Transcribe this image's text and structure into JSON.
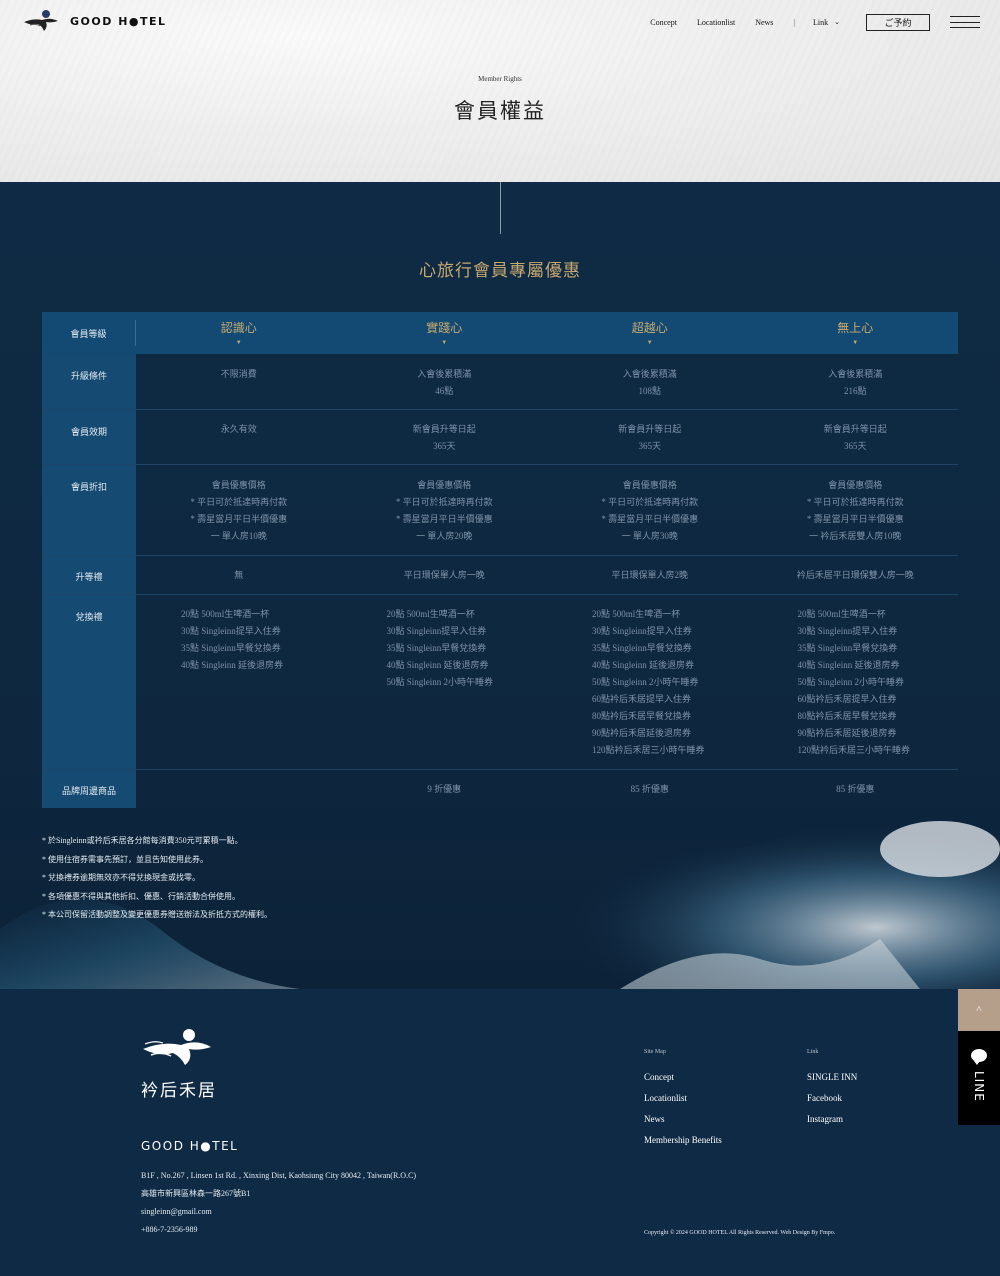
{
  "header": {
    "brand": "GOOD H●TEL",
    "nav": [
      "Concept",
      "Locationlist",
      "News"
    ],
    "nav_separator": "|",
    "link_label": "Link",
    "reserve_label": "ご予約"
  },
  "hero": {
    "subtitle": "Member Rights",
    "title": "會員權益"
  },
  "section": {
    "title": "心旅行會員專屬優惠"
  },
  "table": {
    "head_label": "會員等級",
    "tiers": [
      "認識心",
      "實踐心",
      "超越心",
      "無上心"
    ],
    "rows": [
      {
        "label": "升級條件",
        "cells": [
          [
            "",
            "不限消費"
          ],
          [
            "入會後累積滿",
            "46點"
          ],
          [
            "入會後累積滿",
            "108點"
          ],
          [
            "入會後累積滿",
            "216點"
          ]
        ]
      },
      {
        "label": "會員效期",
        "cells": [
          [
            "永久有效"
          ],
          [
            "新會員升等日起",
            "365天"
          ],
          [
            "新會員升等日起",
            "365天"
          ],
          [
            "新會員升等日起",
            "365天"
          ]
        ]
      },
      {
        "label": "會員折扣",
        "cells": [
          [
            "會員優惠價格",
            "* 平日可於抵達時再付款",
            "* 壽星當月平日半價優惠",
            "一 單人房10晚"
          ],
          [
            "會員優惠價格",
            "* 平日可於抵達時再付款",
            "* 壽星當月平日半價優惠",
            "一 單人房20晚"
          ],
          [
            "會員優惠價格",
            "* 平日可於抵達時再付款",
            "* 壽星當月平日半價優惠",
            "一 單人房30晚"
          ],
          [
            "會員優惠價格",
            "* 平日可於抵達時再付款",
            "* 壽星當月平日半價優惠",
            "一 衿后禾居雙人房10晚"
          ]
        ]
      },
      {
        "label": "升等禮",
        "cells": [
          [
            "無"
          ],
          [
            "平日環保單人房一晚"
          ],
          [
            "平日環保單人房2晚"
          ],
          [
            "衿后禾居平日環保雙人房一晚"
          ]
        ]
      },
      {
        "label": "兌換禮",
        "cells": [
          [
            "20點 500ml生啤酒一杯",
            "30點 Singleinn提早入住券",
            "35點 Singleinn早餐兌換券",
            "40點 Singleinn 延後退房券"
          ],
          [
            "20點 500ml生啤酒一杯",
            "30點 Singleinn提早入住券",
            "35點 Singleinn早餐兌換券",
            "40點 Singleinn 延後退房券",
            "50點 Singleinn 2小時午睡券"
          ],
          [
            "20點 500ml生啤酒一杯",
            "30點 Singleinn提早入住券",
            "35點 Singleinn早餐兌換券",
            "40點 Singleinn 延後退房券",
            "50點 Singleinn 2小時午睡券",
            "60點衿后禾居提早入住券",
            "80點衿后禾居早餐兌換券",
            "90點衿后禾居延後退房券",
            "120點衿后禾居三小時午睡券"
          ],
          [
            "20點 500ml生啤酒一杯",
            "30點 Singleinn提早入住券",
            "35點 Singleinn早餐兌換券",
            "40點 Singleinn 延後退房券",
            "50點 Singleinn 2小時午睡券",
            "60點衿后禾居提早入住券",
            "80點衿后禾居早餐兌換券",
            "90點衿后禾居延後退房券",
            "120點衿后禾居三小時午睡券"
          ]
        ]
      },
      {
        "label": "品牌周邊商品",
        "cells": [
          [
            ""
          ],
          [
            "9 折優惠"
          ],
          [
            "85 折優惠"
          ],
          [
            "85 折優惠"
          ]
        ]
      }
    ]
  },
  "notes": [
    "* 於Singleinn或衿后禾居各分館每消費350元可累積一點。",
    "* 使用住宿券需事先預訂，並且告知使用此券。",
    "* 兌換禮券逾期無效亦不得兌換現金或找零。",
    "* 各項優惠不得與其他折扣、優惠、行銷活動合併使用。",
    "* 本公司保留活動調整及變更優惠券贈送辦法及折抵方式的權利。"
  ],
  "footer": {
    "brand_cn": "衿后禾居",
    "brand_en": "GOOD H●TEL",
    "address_en": "B1F , No.267 , Linsen 1st Rd. , Xinxing Dist, Kaohsiung City 80042 , Taiwan(R.O.C)",
    "address_cn": "高雄市新興區林森一路267號B1",
    "email": "singleinn@gmail.com",
    "phone": "+886-7-2356-989",
    "sitemap": {
      "heading": "Site Map",
      "items": [
        "Concept",
        "Locationlist",
        "News",
        "Membership Benefits"
      ]
    },
    "links": {
      "heading": "Link",
      "items": [
        "SINGLE INN",
        "Facebook",
        "Instagram"
      ]
    },
    "copyright": "Copyright © 2024 GOOD HOTEL All Rights Reserved. Web Design By Fmpo."
  },
  "side": {
    "top_glyph": "^",
    "line_label": "LINE"
  },
  "colors": {
    "navy": "#0f2a44",
    "table_head": "#124a73",
    "label_col": "#154a72",
    "gold": "#c9a96e",
    "side_top": "#b59f8a"
  }
}
